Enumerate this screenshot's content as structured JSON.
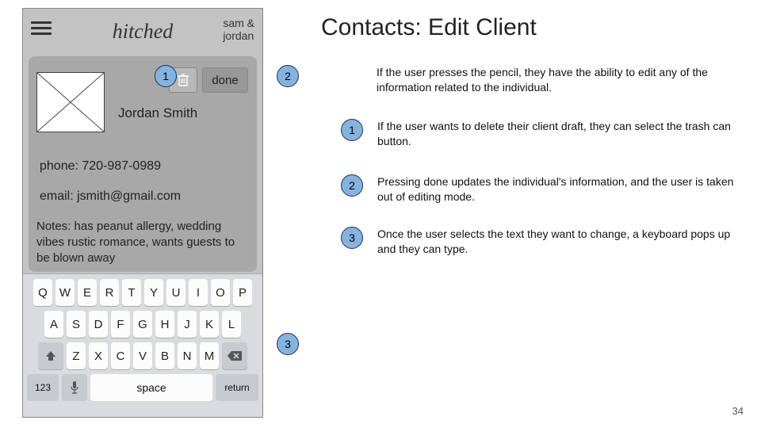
{
  "app": {
    "logo": "hitched",
    "couple_line1": "sam &",
    "couple_line2": "jordan"
  },
  "client": {
    "name": "Jordan Smith",
    "phone_label": "phone: 720-987-0989",
    "email_label": "email: jsmith@gmail.com",
    "notes": "Notes:  has peanut allergy, wedding vibes rustic romance, wants guests to be blown away",
    "done_label": "done"
  },
  "keyboard": {
    "row1": [
      "Q",
      "W",
      "E",
      "R",
      "T",
      "Y",
      "U",
      "I",
      "O",
      "P"
    ],
    "row2": [
      "A",
      "S",
      "D",
      "F",
      "G",
      "H",
      "J",
      "K",
      "L"
    ],
    "row3": [
      "Z",
      "X",
      "C",
      "V",
      "B",
      "N",
      "M"
    ],
    "key123": "123",
    "space": "space",
    "return": "return"
  },
  "callouts": {
    "onphone1": "1",
    "onphone2": "2",
    "onphone3": "3"
  },
  "doc": {
    "title": "Contacts: Edit Client",
    "intro": "If the user presses the pencil, they have the ability to edit any of the information related to the individual.",
    "bullets": [
      {
        "num": "1",
        "text": "If the user wants to delete their client draft, they can select the trash can button."
      },
      {
        "num": "2",
        "text": "Pressing done updates the individual's information, and the user is taken out of editing mode."
      },
      {
        "num": "3",
        "text": "Once the user selects the text they want to change, a keyboard pops up and they can type."
      }
    ],
    "page": "34"
  }
}
